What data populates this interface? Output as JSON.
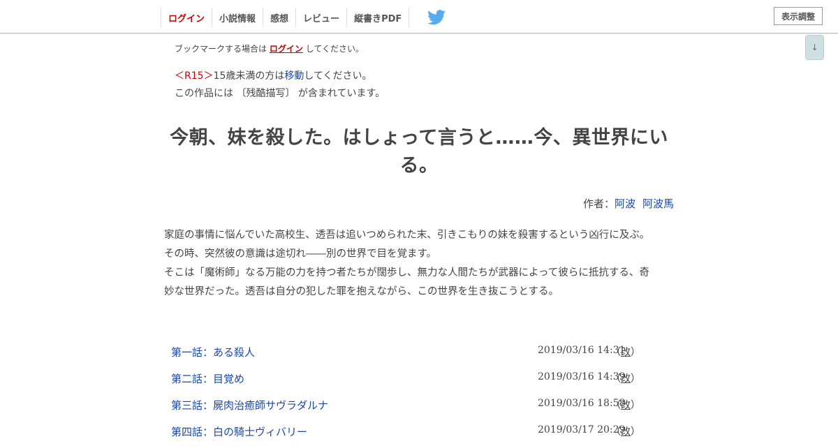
{
  "header": {
    "nav": {
      "login": "ログイン",
      "novel_info": "小説情報",
      "impressions": "感想",
      "review": "レビュー",
      "vertical_pdf": "縦書きPDF"
    },
    "twitter_icon": "twitter-bird-icon",
    "display_settings": "表示調整",
    "scroll_down": "↓"
  },
  "bookmark": {
    "prefix": "ブックマークする場合は",
    "link": "ログイン",
    "suffix": "してください。"
  },
  "notice": {
    "r15": "＜R15＞",
    "age_text": "15歳未満の方は",
    "move_link": "移動",
    "age_suffix": "してください。",
    "content_warning": "この作品には 〔残酷描写〕 が含まれています。"
  },
  "novel": {
    "title_line1": "今朝、妹を殺した。はしょって言うと……今、異世界にい",
    "title_line2": "る。",
    "author_label": "作者：",
    "author_name1": "阿波",
    "author_name2": "阿波馬",
    "synopsis": [
      "家庭の事情に悩んでいた高校生、透吾は追いつめられた末、引きこもりの妹を殺害するという凶行に及ぶ。",
      "その時、突然彼の意識は途切れ――別の世界で目を覚ます。",
      "そこは「魔術師」なる万能の力を持つ者たちが闊歩し、無力な人間たちが武器によって彼らに抵抗する、奇",
      "妙な世界だった。透吾は自分の犯した罪を抱えながら、この世界を生き抜こうとする。"
    ]
  },
  "chapters": [
    {
      "title": "第一話：ある殺人",
      "date": "2019/03/16 14:31",
      "kai_open": "（",
      "kai": "改",
      "kai_close": "）"
    },
    {
      "title": "第二話：目覚め",
      "date": "2019/03/16 14:39",
      "kai_open": "（",
      "kai": "改",
      "kai_close": "）"
    },
    {
      "title": "第三話：屍肉治癒師サヴラダルナ",
      "date": "2019/03/16 18:58",
      "kai_open": "（",
      "kai": "改",
      "kai_close": "）"
    },
    {
      "title": "第四話：白の騎士ヴィバリー",
      "date": "2019/03/17 20:29",
      "kai_open": "（",
      "kai": "改",
      "kai_close": "）"
    }
  ],
  "colors": {
    "accent_red": "#cc0000",
    "link_blue": "#1a47a8",
    "twitter_blue": "#55acee"
  }
}
